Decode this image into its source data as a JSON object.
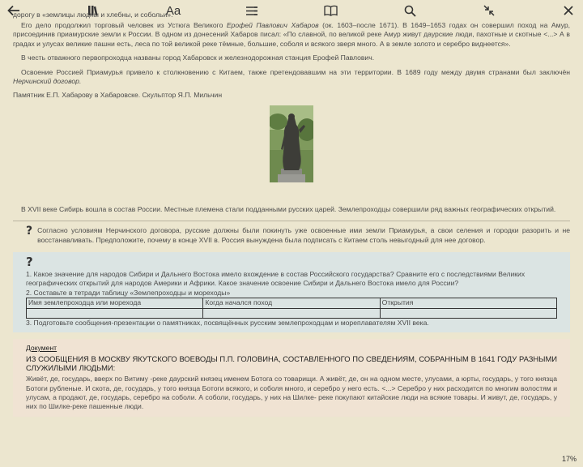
{
  "toolbar": {
    "back_icon": "arrow-left-icon",
    "library_icon": "library-icon",
    "font_label": "Aa",
    "toc_icon": "list-icon",
    "bookmark_icon": "book-icon",
    "search_icon": "search-icon",
    "collapse_icon": "collapse-icon",
    "close_icon": "close-icon"
  },
  "text": {
    "p0": "назвали Даурией. Поярков прошёл весь Амур и добрался до Тихого океана. Он собрал ценные сведения о природе и населении Приамурья, был первым, кто проложил дорогу в «землицы людны и хлебны, и собольи».",
    "p1_a": "Его дело продолжил торговый человек из Устюга Великого ",
    "p1_name": "Ерофей Павлович Хабаров",
    "p1_b": " (ок. 1603–после 1671). В 1649–1653 годах он совершил поход на Амур, присоединив приамурские земли к России. В одном из донесений Хабаров писал: «По славной, по великой реке Амур живут даурские люди, пахотные и скотные <...> А в градах и улусах великие пашни есть, леса по той великой реке тёмные, большие, соболя и всякого зверя много. А в земле золото и серебро виднеется».",
    "p2": "В честь отважного первопроходца названы город Хабаровск и железнодорожная станция Ерофей Павлович.",
    "p3_a": "Освоение Россией Приамурья привело к столкновению с Китаем, также претендовавшим на эти территории. В 1689 году между двумя странами был заключён ",
    "p3_treaty": "Нерчинский договор.",
    "caption": "Памятник Е.П. Хабарову в Хабаровске. Скульптор Я.П. Мильчин",
    "p4": "В XVII веке Сибирь вошла в состав России. Местные племена стали подданными русских царей. Землепроходцы совершили ряд важных географических открытий."
  },
  "question": {
    "mark": "?",
    "text": "Согласно условиям Нерчинского договора, русские должны были покинуть уже освоенные ими земли Приамурья, а свои селения и городки разорить и не восстанавливать. Предположите, почему в конце XVII в. Россия вынуждена была подписать с Китаем столь невыгодный для нее договор."
  },
  "tasks": {
    "mark": "?",
    "t1": "1. Какое значение для народов Сибири и Дальнего Востока имело вхождение в состав Российского государства? Сравните его с последствиями Великих географических открытий для народов Америки и Африки. Какое значение освоение Сибири и Дальнего Востока имело для России?",
    "t2": "2. Составьте в тетради таблицу «Землепроходцы и мореходы»",
    "table_headers": [
      "Имя землепроходца или морехода",
      "Когда начался поход",
      "Открытия"
    ],
    "t3": "3. Подготовьте сообщения-презентации о памятниках, посвящённых русским землепроходцам и мореплавателям XVII века."
  },
  "document": {
    "label": "Документ",
    "title": "ИЗ СООБЩЕНИЯ В МОСКВУ ЯКУТСКОГО ВОЕВОДЫ П.П. ГОЛОВИНА, СОСТАВЛЕННОГО ПО СВЕДЕНИЯМ, СОБРАННЫМ В 1641 ГОДУ РАЗНЫМИ СЛУЖИЛЫМИ ЛЮДЬМИ:",
    "body": "Живёт, де, государь, вверх по Витиму -реке даурский князец именем Ботога со товарищи. А живёт, де, он на одном месте, улусами, а юрты, государь, у того князца Ботоги рубленые. И скота, де, государь, у того князца Ботоги всякого, и соболя много, и серебро у него есть. <...> Серебро у них расходится по многим волостям и улусам, а продают, де, государь, серебро на соболи. А соболи, государь, у них на Шилке- реке покупают китайские люди на всякие товары. И живут, де, государь, у них по Шилке-реке пашенные люди."
  },
  "status": {
    "progress_label": "17%",
    "progress": 0.17
  }
}
